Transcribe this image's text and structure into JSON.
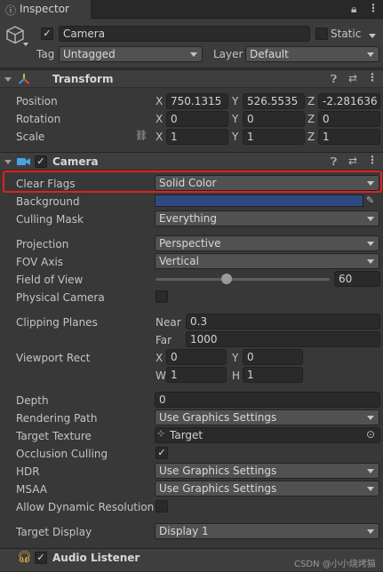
{
  "window": {
    "tab": "Inspector"
  },
  "object": {
    "name": "Camera",
    "static_label": "Static",
    "tag_label": "Tag",
    "tag_value": "Untagged",
    "layer_label": "Layer",
    "layer_value": "Default"
  },
  "transform": {
    "title": "Transform",
    "position_label": "Position",
    "rotation_label": "Rotation",
    "scale_label": "Scale",
    "position": {
      "x": "750.1315",
      "y": "526.5535",
      "z": "-2.281636"
    },
    "rotation": {
      "x": "0",
      "y": "0",
      "z": "0"
    },
    "scale": {
      "x": "1",
      "y": "1",
      "z": "1"
    }
  },
  "axes": {
    "x": "X",
    "y": "Y",
    "z": "Z",
    "w": "W",
    "h": "H"
  },
  "camera": {
    "title": "Camera",
    "clear_flags_label": "Clear Flags",
    "clear_flags": "Solid Color",
    "background_label": "Background",
    "background_color": "#2f4a80",
    "culling_mask_label": "Culling Mask",
    "culling_mask": "Everything",
    "projection_label": "Projection",
    "projection": "Perspective",
    "fov_axis_label": "FOV Axis",
    "fov_axis": "Vertical",
    "fov_label": "Field of View",
    "fov_value": "60",
    "fov_slider_fraction": 0.41,
    "physical_label": "Physical Camera",
    "clipping_label": "Clipping Planes",
    "near_label": "Near",
    "near_value": "0.3",
    "far_label": "Far",
    "far_value": "1000",
    "viewport_label": "Viewport Rect",
    "viewport": {
      "x": "0",
      "y": "0",
      "w": "1",
      "h": "1"
    },
    "depth_label": "Depth",
    "depth": "0",
    "rendering_path_label": "Rendering Path",
    "rendering_path": "Use Graphics Settings",
    "target_texture_label": "Target Texture",
    "target_texture": "Target",
    "occlusion_label": "Occlusion Culling",
    "hdr_label": "HDR",
    "hdr": "Use Graphics Settings",
    "msaa_label": "MSAA",
    "msaa": "Use Graphics Settings",
    "dynres_label": "Allow Dynamic Resolution",
    "target_display_label": "Target Display",
    "target_display": "Display 1"
  },
  "audio": {
    "title": "Audio Listener"
  },
  "watermark": "CSDN @小小烧烤猫猫",
  "colors": {
    "highlight": "#e2211c",
    "accent": "#4aa3df"
  }
}
